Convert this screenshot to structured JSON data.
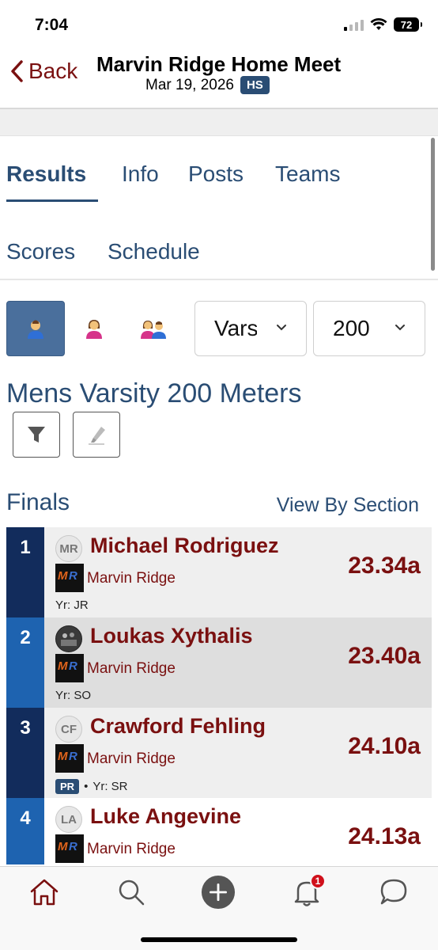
{
  "status": {
    "time": "7:04",
    "battery": "72"
  },
  "nav": {
    "back_label": "Back",
    "title": "Marvin Ridge Home Meet",
    "date": "Mar 19, 2026",
    "level_badge": "HS"
  },
  "tabs": [
    {
      "label": "Results",
      "active": true
    },
    {
      "label": "Info"
    },
    {
      "label": "Posts"
    },
    {
      "label": "Teams"
    },
    {
      "label": "Scores"
    },
    {
      "label": "Schedule"
    }
  ],
  "filters": {
    "gender_buttons": [
      {
        "icon": "male-athlete-icon",
        "active": true
      },
      {
        "icon": "female-athlete-icon"
      },
      {
        "icon": "mixed-athletes-icon"
      }
    ],
    "division_select": "Varsity",
    "event_select": "200 Meters"
  },
  "event_title": "Mens Varsity 200 Meters",
  "section": {
    "label": "Finals",
    "view_by_label": "View By Section"
  },
  "results": [
    {
      "place": "1",
      "initials": "MR",
      "name": "Michael Rodriguez",
      "team": "Marvin Ridge",
      "year": "Yr: JR",
      "pr": "",
      "mark": "23.34a",
      "place_color": "#122c5c",
      "row_bg": "#efefef"
    },
    {
      "place": "2",
      "initials": "",
      "name": "Loukas Xythalis",
      "team": "Marvin Ridge",
      "year": "Yr: SO",
      "pr": "",
      "mark": "23.40a",
      "place_color": "#1e63b0",
      "row_bg": "#dedede"
    },
    {
      "place": "3",
      "initials": "CF",
      "name": "Crawford Fehling",
      "team": "Marvin Ridge",
      "year": "Yr: SR",
      "pr": "PR",
      "mark": "24.10a",
      "place_color": "#122c5c",
      "row_bg": "#efefef"
    },
    {
      "place": "4",
      "initials": "LA",
      "name": "Luke Angevine",
      "team": "Marvin Ridge",
      "year": "",
      "pr": "",
      "mark": "24.13a",
      "place_color": "#1e63b0",
      "row_bg": "#ffffff"
    }
  ],
  "team_logo_text": "MR",
  "tabbar": {
    "items": [
      "home-icon",
      "search-icon",
      "add-icon",
      "notifications-icon",
      "messages-icon"
    ],
    "notification_count": "1"
  },
  "colors": {
    "accent_blue": "#2a4d74",
    "maroon": "#7a1010"
  }
}
